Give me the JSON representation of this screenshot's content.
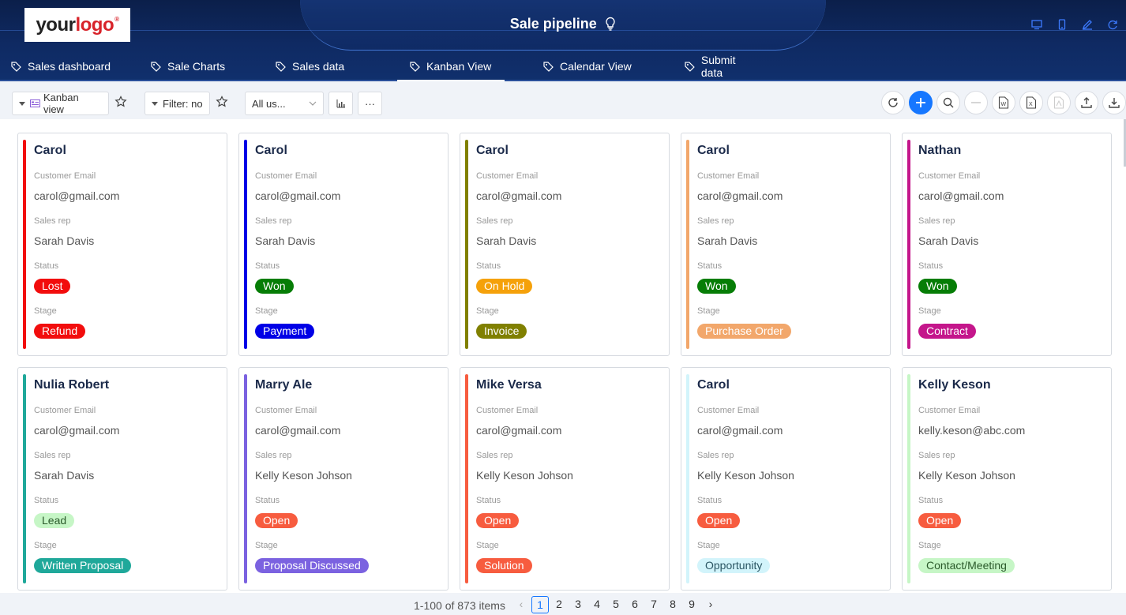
{
  "brand": {
    "logo_part1": "your",
    "logo_part2": "logo",
    "logo_mark": "®"
  },
  "app": {
    "title": "Sale pipeline"
  },
  "nav": {
    "tabs": [
      {
        "label": "Sales dashboard",
        "active": false
      },
      {
        "label": "Sale Charts",
        "active": false
      },
      {
        "label": "Sales data",
        "active": false
      },
      {
        "label": "Kanban View",
        "active": true
      },
      {
        "label": "Calendar View",
        "active": false
      },
      {
        "label": "Submit data",
        "active": false
      }
    ]
  },
  "toolbar": {
    "view_label": "Kanban view",
    "filter_label": "Filter: no",
    "user_select_value": "All us...",
    "more_label": "···"
  },
  "field_labels": {
    "email": "Customer Email",
    "rep": "Sales rep",
    "status": "Status",
    "stage": "Stage"
  },
  "cards": [
    {
      "name": "Carol",
      "email": "carol@gmail.com",
      "rep": "Sarah Davis",
      "status": "Lost",
      "status_color": "#f20d0d",
      "stage": "Refund",
      "stage_color": "#f20d0d",
      "bar_color": "#f20d0d"
    },
    {
      "name": "Carol",
      "email": "carol@gmail.com",
      "rep": "Sarah Davis",
      "status": "Won",
      "status_color": "#067d06",
      "stage": "Payment",
      "stage_color": "#0000e6",
      "bar_color": "#0000e6"
    },
    {
      "name": "Carol",
      "email": "carol@gmail.com",
      "rep": "Sarah Davis",
      "status": "On Hold",
      "status_color": "#f5a10a",
      "stage": "Invoice",
      "stage_color": "#808000",
      "bar_color": "#808000"
    },
    {
      "name": "Carol",
      "email": "carol@gmail.com",
      "rep": "Sarah Davis",
      "status": "Won",
      "status_color": "#067d06",
      "stage": "Purchase Order",
      "stage_color": "#f2a76b",
      "bar_color": "#f2a76b"
    },
    {
      "name": "Nathan",
      "email": "carol@gmail.com",
      "rep": "Sarah Davis",
      "status": "Won",
      "status_color": "#067d06",
      "stage": "Contract",
      "stage_color": "#c4168b",
      "bar_color": "#c4168b"
    },
    {
      "name": "Nulia Robert",
      "email": "carol@gmail.com",
      "rep": "Sarah Davis",
      "status": "Lead",
      "status_color": "#c6f6c6",
      "status_text_color": "#2b5a2b",
      "stage": "Written Proposal",
      "stage_color": "#1fa89a",
      "bar_color": "#1fa89a"
    },
    {
      "name": "Marry Ale",
      "email": "carol@gmail.com",
      "rep": "Kelly Keson Johson",
      "status": "Open",
      "status_color": "#f75c3f",
      "stage": "Proposal Discussed",
      "stage_color": "#7b62e0",
      "bar_color": "#7b62e0"
    },
    {
      "name": "Mike Versa",
      "email": "carol@gmail.com",
      "rep": "Kelly Keson Johson",
      "status": "Open",
      "status_color": "#f75c3f",
      "stage": "Solution",
      "stage_color": "#f75c3f",
      "bar_color": "#f75c3f"
    },
    {
      "name": "Carol",
      "email": "carol@gmail.com",
      "rep": "Kelly Keson Johson",
      "status": "Open",
      "status_color": "#f75c3f",
      "stage": "Opportunity",
      "stage_color": "#d2f4fb",
      "stage_text_color": "#2a5563",
      "bar_color": "#d2f4fb"
    },
    {
      "name": "Kelly Keson",
      "email": "kelly.keson@abc.com",
      "rep": "Kelly Keson Johson",
      "status": "Open",
      "status_color": "#f75c3f",
      "stage": "Contact/Meeting",
      "stage_color": "#c6f6c6",
      "stage_text_color": "#2b5a2b",
      "bar_color": "#c6f6c6"
    }
  ],
  "pagination": {
    "summary": "1-100 of 873 items",
    "pages": [
      "1",
      "2",
      "3",
      "4",
      "5",
      "6",
      "7",
      "8",
      "9"
    ],
    "current": "1",
    "prev": "‹",
    "next": "›"
  }
}
